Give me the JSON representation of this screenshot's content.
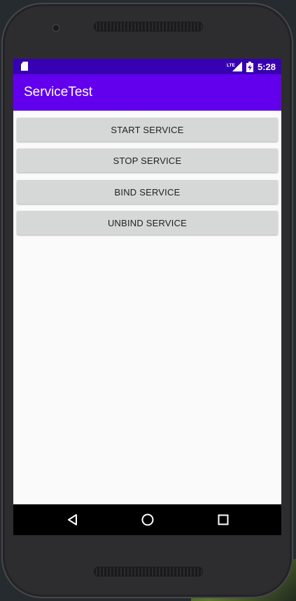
{
  "status_bar": {
    "time": "5:28",
    "network_label": "LTE",
    "sd_card_icon": "sd-card-icon",
    "signal_icon": "lte-signal-icon",
    "battery_icon": "battery-charging-icon",
    "background_color": "#3700b3"
  },
  "app_bar": {
    "title": "ServiceTest",
    "background_color": "#6200ee"
  },
  "buttons": [
    {
      "label": "START SERVICE"
    },
    {
      "label": "STOP SERVICE"
    },
    {
      "label": "BIND SERVICE"
    },
    {
      "label": "UNBIND SERVICE"
    }
  ],
  "nav_bar": {
    "back_icon": "back-triangle-icon",
    "home_icon": "home-circle-icon",
    "recents_icon": "recents-square-icon"
  }
}
